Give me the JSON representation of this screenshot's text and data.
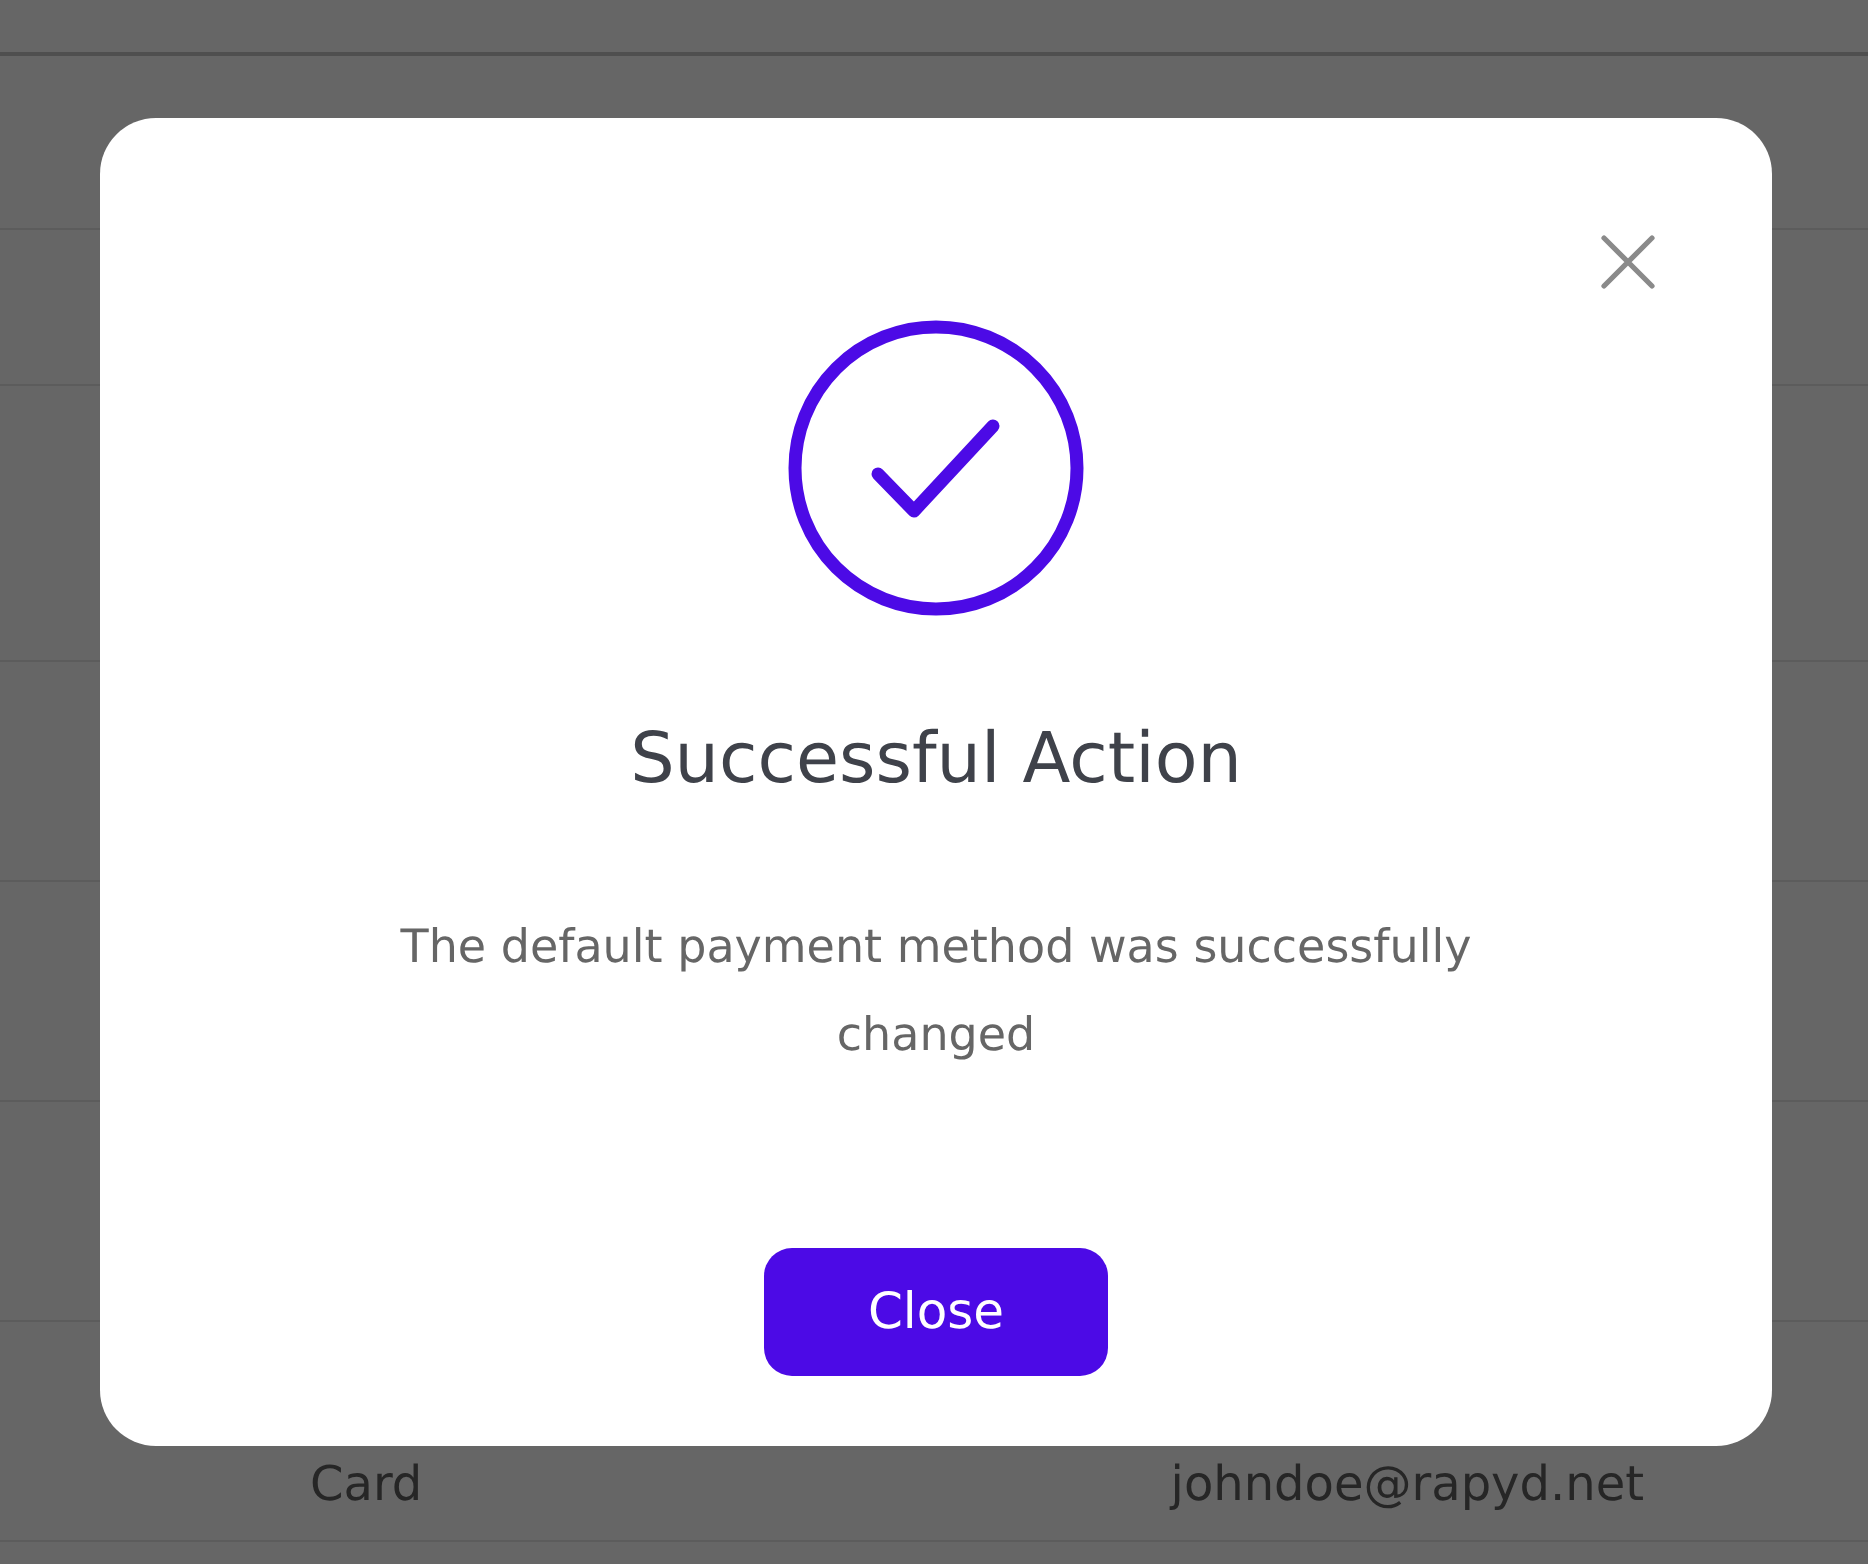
{
  "background_table": {
    "rows": [
      {
        "column_1": "Card",
        "column_2": "johndoe@rapyd.net"
      }
    ]
  },
  "dialog": {
    "title": "Successful Action",
    "message": "The default payment method was successfully changed",
    "buttons": [
      {
        "label": "Close",
        "kind": "primary"
      }
    ]
  }
}
